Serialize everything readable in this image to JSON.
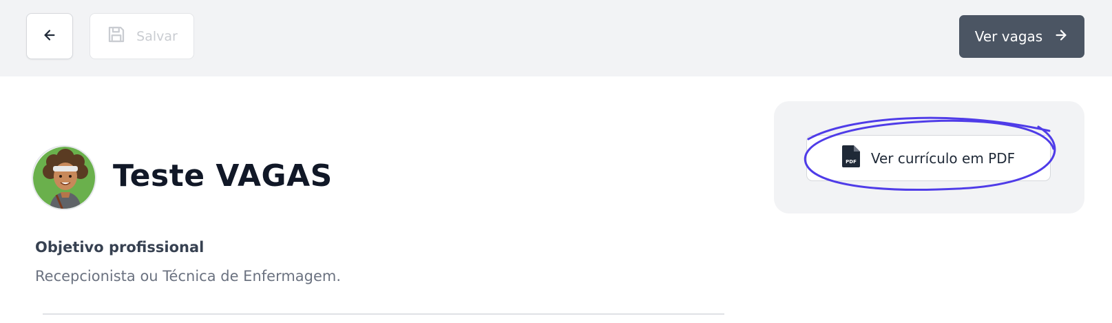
{
  "toolbar": {
    "back_icon": "arrow-left-icon",
    "save_label": "Salvar",
    "save_icon": "floppy-disk-icon",
    "next_label": "Ver vagas",
    "next_icon": "arrow-right-icon"
  },
  "resume": {
    "pdf_label": "Ver currículo em PDF",
    "pdf_icon": "pdf-file-icon",
    "pdf_icon_text": "PDF"
  },
  "profile": {
    "name": "Teste VAGAS",
    "avatar_icon": "avatar-illustration"
  },
  "objective": {
    "label": "Objetivo profissional",
    "value": "Recepcionista ou Técnica de Enfermagem."
  },
  "colors": {
    "topbar_bg": "#f2f3f5",
    "primary_button": "#4b5563",
    "highlight_stroke": "#4f3ce8",
    "avatar_bg": "#6ab04c"
  }
}
